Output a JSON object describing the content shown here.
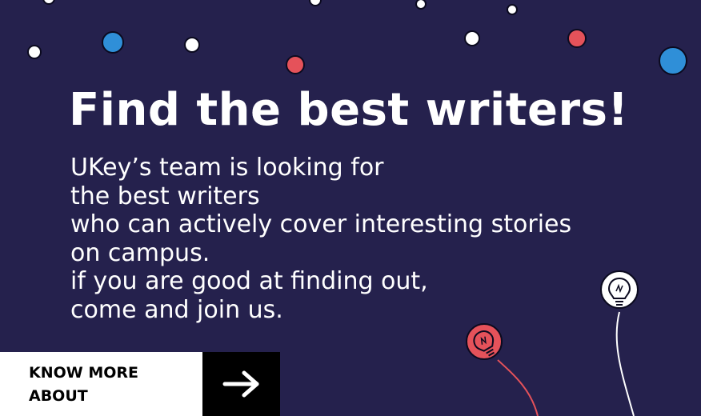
{
  "banner": {
    "headline": "Find the best writers!",
    "body_lines": [
      "UKey’s team is looking for",
      "the best writers",
      "who can actively cover interesting stories",
      "on campus.",
      "if you are good at finding out,",
      "come and join us."
    ],
    "cta": {
      "label_lines": [
        "KNOW MORE",
        "ABOUT"
      ],
      "icon": "arrow-right-icon"
    },
    "decorations": {
      "dot_colors": [
        "#ffffff",
        "#2f8fd8",
        "#e5525a"
      ],
      "bulb_icons": [
        "lightbulb-icon-white",
        "lightbulb-icon-red"
      ]
    }
  },
  "colors": {
    "background": "#25214d",
    "text": "#ffffff",
    "accent_blue": "#2f8fd8",
    "accent_red": "#e5525a",
    "cta_light": "#ffffff",
    "cta_dark": "#000000"
  }
}
